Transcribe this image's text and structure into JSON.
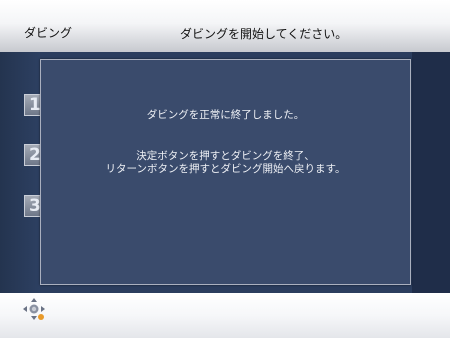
{
  "header": {
    "title": "ダビング",
    "instruction": "ダビングを開始してください。"
  },
  "steps": [
    "1",
    "2",
    "3"
  ],
  "dialog": {
    "line1": "ダビングを正常に終了しました。",
    "line2": "決定ボタンを押すとダビングを終了、",
    "line3": "リターンボタンを押すとダビング開始へ戻ります。"
  },
  "footer": {
    "icon": "dpad-icon"
  },
  "colors": {
    "panel_bg": "#2b3d5e",
    "dialog_bg": "#3a4b6c",
    "dialog_text": "#eef0f5",
    "dpad_accent": "#e89a2a"
  }
}
